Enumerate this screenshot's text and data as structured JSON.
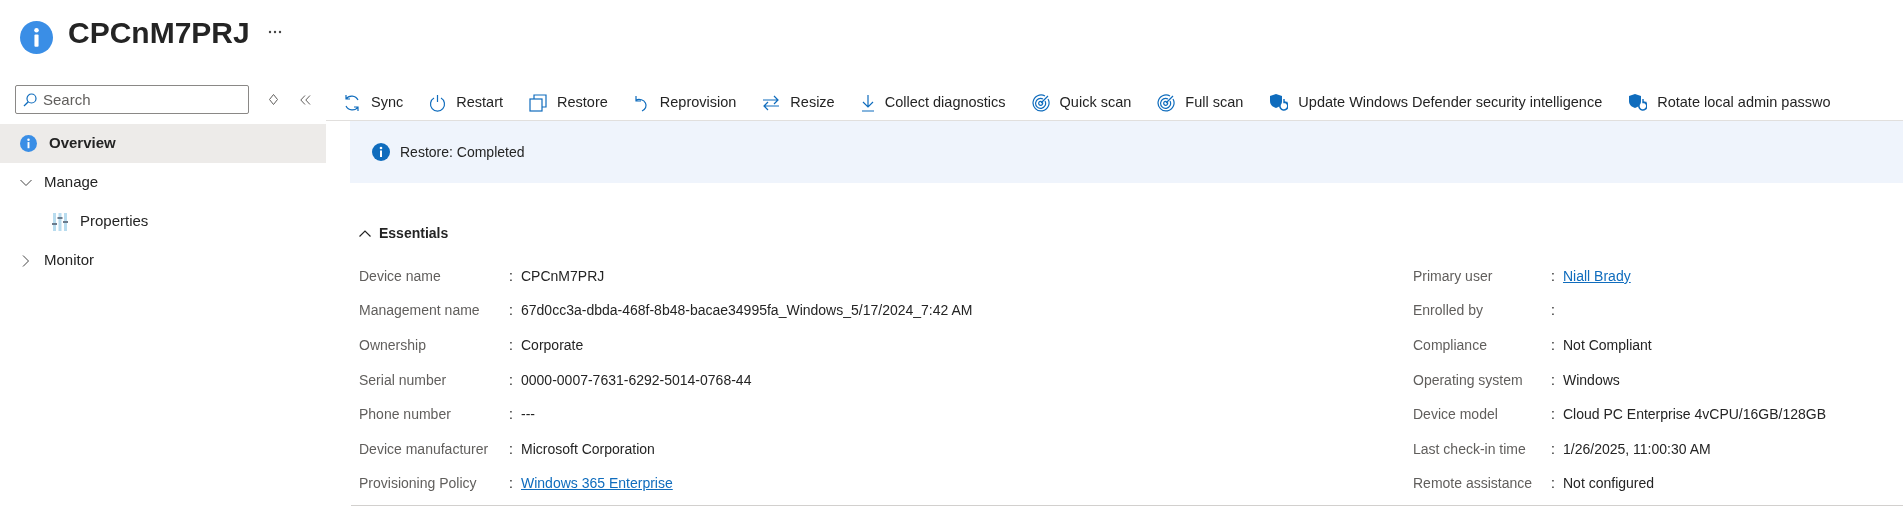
{
  "header": {
    "title": "CPCnM7PRJ"
  },
  "sidebar": {
    "search": {
      "placeholder": "Search"
    },
    "items": [
      {
        "label": "Overview",
        "selected": true,
        "expanded": false
      },
      {
        "label": "Manage",
        "selected": false,
        "expanded": true,
        "children": [
          {
            "label": "Properties",
            "selected": false
          }
        ]
      },
      {
        "label": "Monitor",
        "selected": false,
        "expanded": false
      }
    ]
  },
  "toolbar": [
    "Sync",
    "Restart",
    "Restore",
    "Reprovision",
    "Resize",
    "Collect diagnostics",
    "Quick scan",
    "Full scan",
    "Update Windows Defender security intelligence",
    "Rotate local admin passwo"
  ],
  "banner": {
    "text": "Restore: Completed"
  },
  "essentials": {
    "title": "Essentials",
    "expanded": true,
    "left": [
      {
        "label": "Device name",
        "colon": ":",
        "value": "CPCnM7PRJ",
        "kind": "text"
      },
      {
        "label": "Management name",
        "colon": ":",
        "value": "67d0cc3a-dbda-468f-8b48-bacae34995fa_Windows_5/17/2024_7:42 AM",
        "kind": "text"
      },
      {
        "label": "Ownership",
        "colon": ":",
        "value": "Corporate",
        "kind": "text"
      },
      {
        "label": "Serial number",
        "colon": ":",
        "value": "0000-0007-7631-6292-5014-0768-44",
        "kind": "text"
      },
      {
        "label": "Phone number",
        "colon": ":",
        "value": "---",
        "kind": "text"
      },
      {
        "label": "Device manufacturer",
        "colon": ":",
        "value": "Microsoft Corporation",
        "kind": "text"
      },
      {
        "label": "Provisioning Policy",
        "colon": ":",
        "value": "Windows 365 Enterprise",
        "kind": "link"
      }
    ],
    "right": [
      {
        "label": "Primary user",
        "colon": ":",
        "value": "Niall Brady",
        "kind": "link"
      },
      {
        "label": "Enrolled by",
        "colon": ":"
      },
      {
        "label": "Compliance",
        "colon": ":",
        "value": "Not Compliant",
        "kind": "text"
      },
      {
        "label": "Operating system",
        "colon": ":",
        "value": "Windows",
        "kind": "text"
      },
      {
        "label": "Device model",
        "colon": ":",
        "value": "Cloud PC Enterprise 4vCPU/16GB/128GB",
        "kind": "text"
      },
      {
        "label": "Last check-in time",
        "colon": ":",
        "value": "1/26/2025, 11:00:30 AM",
        "kind": "text"
      },
      {
        "label": "Remote assistance",
        "colon": ":",
        "value": "Not configured",
        "kind": "text"
      }
    ]
  }
}
